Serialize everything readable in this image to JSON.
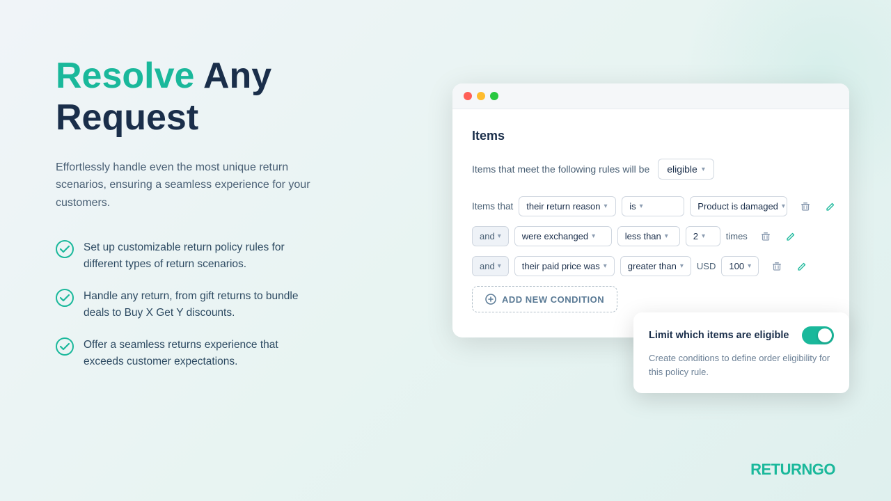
{
  "headline": {
    "resolve": "Resolve",
    "rest": " Any\nRequest"
  },
  "subtitle": "Effortlessly handle even the most unique return scenarios, ensuring a seamless experience for your customers.",
  "features": [
    "Set up customizable return policy rules for different types of return scenarios.",
    "Handle any return, from gift returns to bundle deals to Buy X Get Y discounts.",
    "Offer a seamless returns experience that exceeds customer expectations."
  ],
  "browser": {
    "section_title": "Items",
    "rules_label": "Items that meet the following rules will be",
    "eligible_option": "eligible",
    "condition1": {
      "prefix": "Items that",
      "field1": "their return reason",
      "operator": "is",
      "value": "Product is damaged"
    },
    "condition2": {
      "prefix": "and",
      "field1": "were exchanged",
      "operator": "less than",
      "value": "2",
      "suffix": "times"
    },
    "condition3": {
      "prefix": "and",
      "field1": "their paid price was",
      "operator": "greater than",
      "currency": "USD",
      "value": "100"
    },
    "add_condition_label": "ADD NEW CONDITION"
  },
  "tooltip": {
    "title": "Limit which items are eligible",
    "description": "Create conditions to define order eligibility for this policy rule."
  },
  "logo": {
    "part1": "RETURN",
    "part2": "GO"
  }
}
